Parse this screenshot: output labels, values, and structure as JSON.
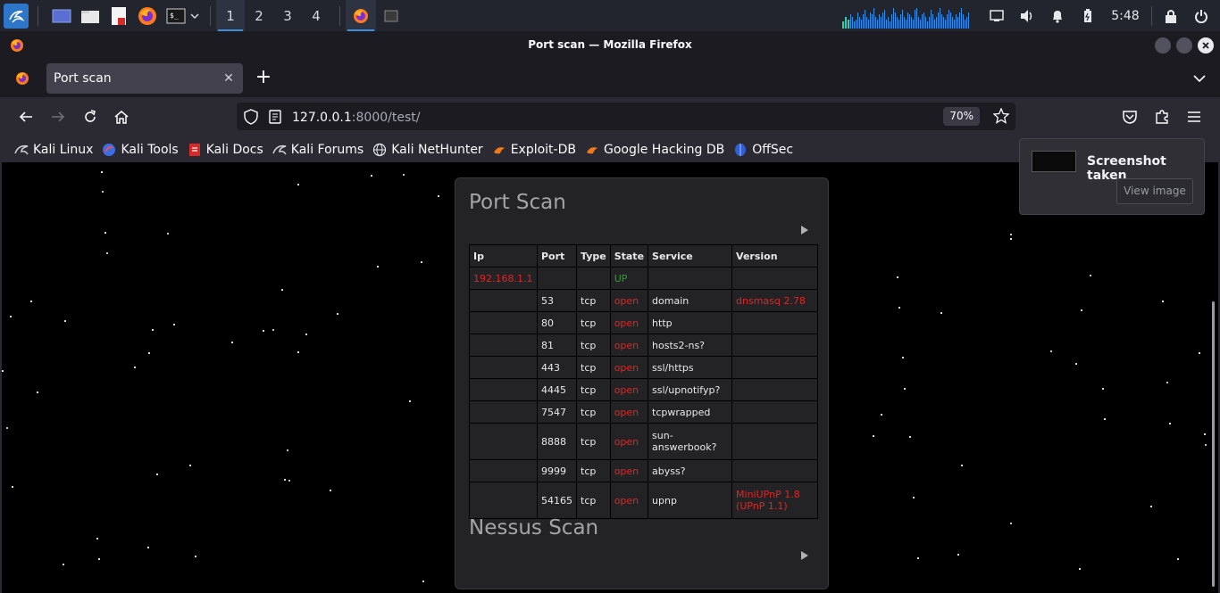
{
  "taskbar": {
    "workspaces": [
      "1",
      "2",
      "3",
      "4"
    ],
    "clock": "5:48",
    "graph_levels": [
      0.3,
      0.5,
      0.4,
      0.6,
      0.5,
      0.3,
      0.4,
      0.7,
      0.5,
      0.4,
      0.6,
      0.8,
      0.5,
      0.4,
      0.7,
      0.6,
      0.9,
      0.5,
      0.4,
      0.6,
      0.5,
      0.7,
      0.8,
      0.4,
      0.5,
      0.3,
      0.6,
      0.9,
      0.7,
      0.5,
      0.4,
      0.6,
      0.8,
      0.5,
      0.4,
      0.7,
      0.6,
      0.5,
      0.4,
      0.8,
      0.9,
      0.5,
      0.4,
      0.6,
      0.7,
      0.5,
      0.3,
      0.5,
      0.8,
      0.6,
      0.4,
      0.5,
      0.7,
      0.9,
      0.6,
      0.5,
      0.4,
      0.6,
      0.8,
      0.7,
      0.5,
      0.4,
      0.6,
      0.5,
      0.7,
      0.9,
      0.6,
      0.4,
      0.5,
      0.7
    ]
  },
  "window": {
    "title": "Port scan — Mozilla Firefox"
  },
  "tab": {
    "title": "Port scan"
  },
  "urlbar": {
    "host": "127.0.0.1",
    "path": ":8000/test/",
    "zoom": "70%"
  },
  "bookmarks": [
    {
      "label": "Kali Linux",
      "icon": "kali-dragon-icon"
    },
    {
      "label": "Kali Tools",
      "icon": "kali-tools-icon"
    },
    {
      "label": "Kali Docs",
      "icon": "kali-docs-icon"
    },
    {
      "label": "Kali Forums",
      "icon": "kali-dragon-icon"
    },
    {
      "label": "Kali NetHunter",
      "icon": "globe-icon"
    },
    {
      "label": "Exploit-DB",
      "icon": "exploit-db-icon"
    },
    {
      "label": "Google Hacking DB",
      "icon": "exploit-db-icon"
    },
    {
      "label": "OffSec",
      "icon": "offsec-icon"
    }
  ],
  "page": {
    "port_scan_title": "Port Scan",
    "nessus_scan_title": "Nessus Scan",
    "table": {
      "headers": [
        "Ip",
        "Port",
        "Type",
        "State",
        "Service",
        "Version"
      ],
      "rows": [
        [
          "192.168.1.1",
          "",
          "",
          "UP",
          "",
          ""
        ],
        [
          "",
          "53",
          "tcp",
          "open",
          "domain",
          "dnsmasq 2.78"
        ],
        [
          "",
          "80",
          "tcp",
          "open",
          "http",
          ""
        ],
        [
          "",
          "81",
          "tcp",
          "open",
          "hosts2-ns?",
          ""
        ],
        [
          "",
          "443",
          "tcp",
          "open",
          "ssl/https",
          ""
        ],
        [
          "",
          "4445",
          "tcp",
          "open",
          "ssl/upnotifyp?",
          ""
        ],
        [
          "",
          "7547",
          "tcp",
          "open",
          "tcpwrapped",
          ""
        ],
        [
          "",
          "8888",
          "tcp",
          "open",
          "sun-answerbook?",
          ""
        ],
        [
          "",
          "9999",
          "tcp",
          "open",
          "abyss?",
          ""
        ],
        [
          "",
          "54165",
          "tcp",
          "open",
          "upnp",
          "MiniUPnP 1.8 (UPnP 1.1)"
        ]
      ]
    }
  },
  "notification": {
    "title": "Screenshot taken",
    "button": "View image"
  },
  "colors": {
    "accent": "#3d8fe0",
    "error_red": "#e02525",
    "status_green": "#27a327"
  }
}
